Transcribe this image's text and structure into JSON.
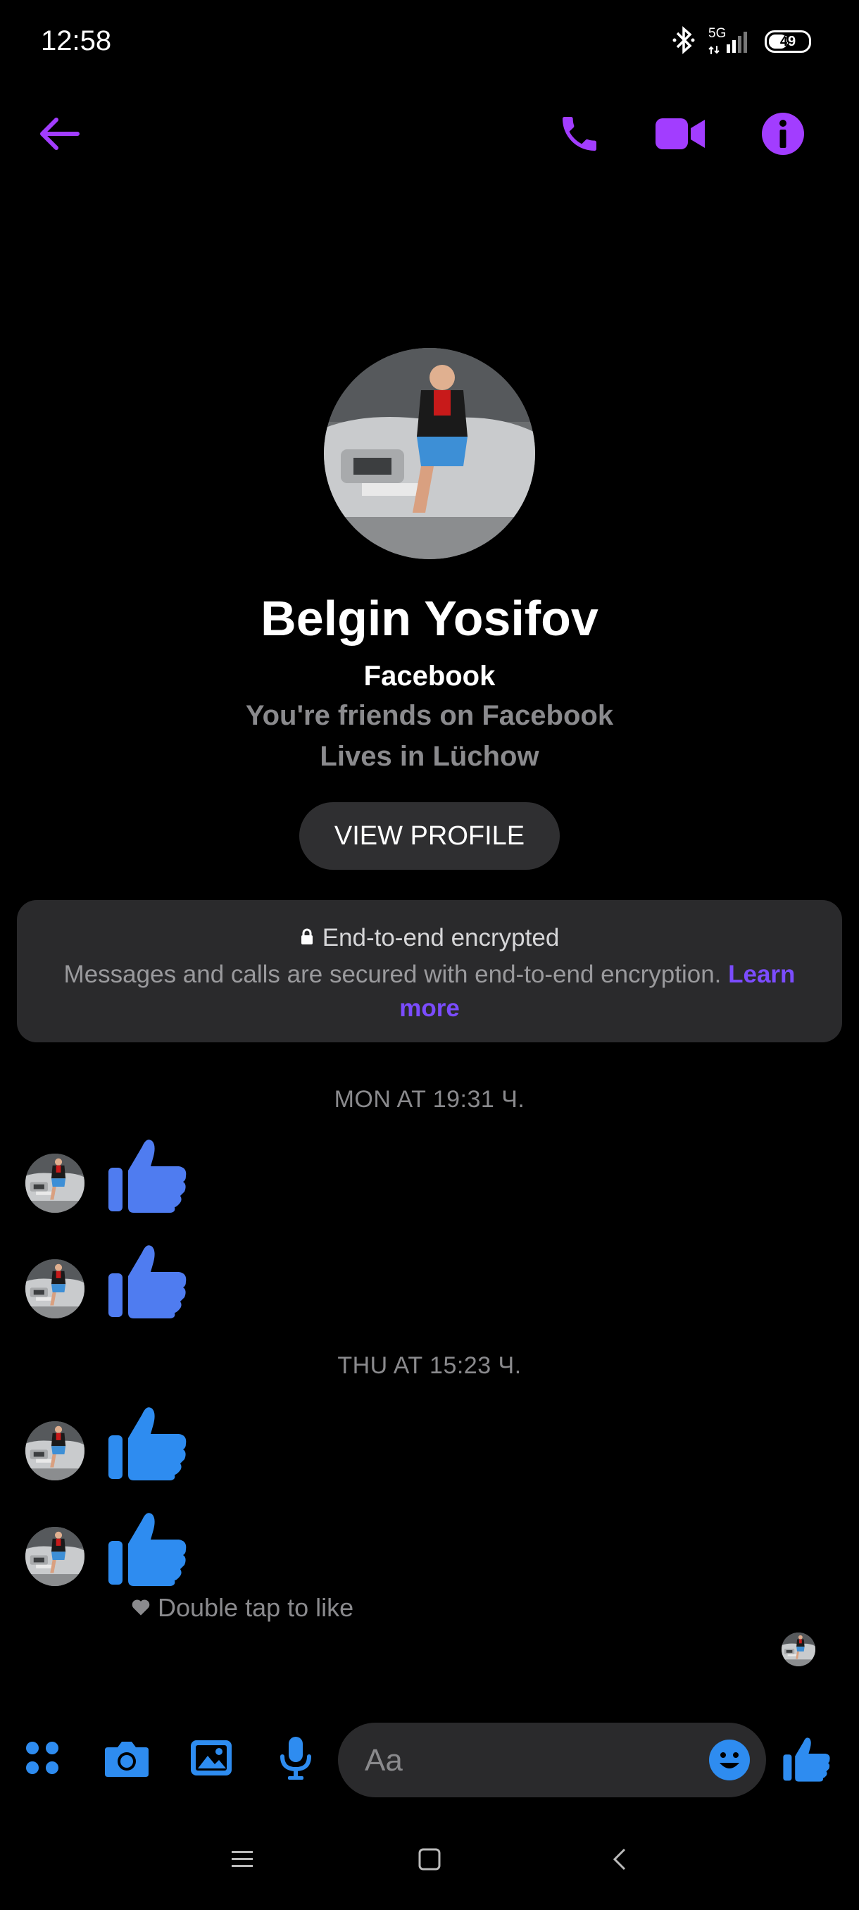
{
  "status_bar": {
    "time": "12:58",
    "network": "5G",
    "battery": "49"
  },
  "header": {
    "icons": [
      "back-arrow-icon",
      "phone-icon",
      "video-icon",
      "info-icon"
    ],
    "accent": "#a23dff"
  },
  "profile": {
    "name": "Belgin Yosifov",
    "source": "Facebook",
    "friends_text": "You're friends on Facebook",
    "lives_text": "Lives in Lüchow",
    "view_profile_label": "VIEW PROFILE"
  },
  "encryption": {
    "title": "End-to-end encrypted",
    "body": "Messages and calls are secured with end-to-end encryption.",
    "learn_more": "Learn more",
    "link_color": "#7b4cff"
  },
  "conversation": {
    "groups": [
      {
        "timestamp": "MON AT 19:31 Ч.",
        "messages": [
          "like",
          "like"
        ]
      },
      {
        "timestamp": "THU AT 15:23 Ч.",
        "messages": [
          "like",
          "like"
        ]
      }
    ],
    "double_tap_hint": "Double tap to like",
    "like_color": "#4f7cf0"
  },
  "composer": {
    "placeholder": "Aa",
    "icons": [
      "apps-icon",
      "camera-icon",
      "gallery-icon",
      "microphone-icon",
      "emoji-icon",
      "thumbs-up-icon"
    ],
    "icon_color": "#2e8cf0"
  },
  "nav_bar": {
    "icons": [
      "menu-icon",
      "home-icon",
      "back-icon"
    ]
  }
}
